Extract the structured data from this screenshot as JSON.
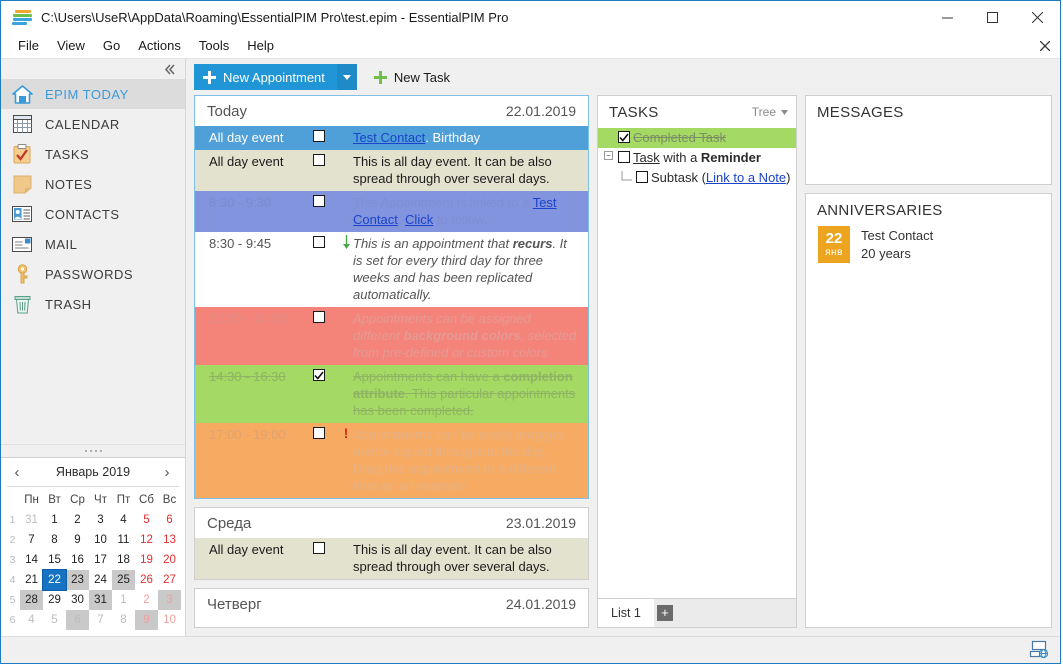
{
  "window": {
    "title": "C:\\Users\\UseR\\AppData\\Roaming\\EssentialPIM Pro\\test.epim - EssentialPIM Pro",
    "minimize_label": "Minimize",
    "maximize_label": "Maximize",
    "close_label": "Close"
  },
  "menu": {
    "items": [
      "File",
      "View",
      "Go",
      "Actions",
      "Tools",
      "Help"
    ],
    "close_label": "Close document"
  },
  "sidebar": {
    "collapse_label": "«",
    "items": [
      {
        "label": "EPIM TODAY",
        "icon": "home-icon",
        "active": true
      },
      {
        "label": "CALENDAR",
        "icon": "calendar-icon",
        "active": false
      },
      {
        "label": "TASKS",
        "icon": "tasks-clipboard-icon",
        "active": false
      },
      {
        "label": "NOTES",
        "icon": "note-icon",
        "active": false
      },
      {
        "label": "CONTACTS",
        "icon": "contact-card-icon",
        "active": false
      },
      {
        "label": "MAIL",
        "icon": "envelope-icon",
        "active": false
      },
      {
        "label": "PASSWORDS",
        "icon": "key-icon",
        "active": false
      },
      {
        "label": "TRASH",
        "icon": "trash-icon",
        "active": false
      }
    ]
  },
  "mini_calendar": {
    "title": "Январь 2019",
    "prev_label": "‹",
    "next_label": "›",
    "weekday_headers": [
      "Пн",
      "Вт",
      "Ср",
      "Чт",
      "Пт",
      "Сб",
      "Вс"
    ],
    "week_numbers": [
      "1",
      "2",
      "3",
      "4",
      "5",
      "6"
    ],
    "weeks": [
      [
        {
          "d": "31",
          "dim": true
        },
        {
          "d": "1"
        },
        {
          "d": "2"
        },
        {
          "d": "3"
        },
        {
          "d": "4"
        },
        {
          "d": "5",
          "sun": true
        },
        {
          "d": "6",
          "sun": true
        }
      ],
      [
        {
          "d": "7"
        },
        {
          "d": "8"
        },
        {
          "d": "9"
        },
        {
          "d": "10"
        },
        {
          "d": "11"
        },
        {
          "d": "12",
          "sun": true
        },
        {
          "d": "13",
          "sun": true
        }
      ],
      [
        {
          "d": "14"
        },
        {
          "d": "15"
        },
        {
          "d": "16"
        },
        {
          "d": "17"
        },
        {
          "d": "18"
        },
        {
          "d": "19",
          "sun": true
        },
        {
          "d": "20",
          "sun": true
        }
      ],
      [
        {
          "d": "21"
        },
        {
          "d": "22",
          "sel": true
        },
        {
          "d": "23",
          "shade": true
        },
        {
          "d": "24"
        },
        {
          "d": "25",
          "shade": true
        },
        {
          "d": "26",
          "sun": true
        },
        {
          "d": "27",
          "sun": true
        }
      ],
      [
        {
          "d": "28",
          "shade": true
        },
        {
          "d": "29"
        },
        {
          "d": "30"
        },
        {
          "d": "31",
          "shade": true
        },
        {
          "d": "1",
          "dim": true
        },
        {
          "d": "2",
          "dim": true,
          "sun": true
        },
        {
          "d": "3",
          "dim": true,
          "sun": true,
          "shade": true
        }
      ],
      [
        {
          "d": "4",
          "dim": true
        },
        {
          "d": "5",
          "dim": true
        },
        {
          "d": "6",
          "dim": true,
          "shade": true
        },
        {
          "d": "7",
          "dim": true
        },
        {
          "d": "8",
          "dim": true
        },
        {
          "d": "9",
          "dim": true,
          "sun": true,
          "shade": true
        },
        {
          "d": "10",
          "dim": true,
          "sun": true
        }
      ]
    ]
  },
  "toolbar": {
    "new_appointment_label": "New Appointment",
    "new_appointment_dropdown": "▾",
    "new_task_label": "New Task"
  },
  "today": {
    "day_name": "Today",
    "date": "22.01.2019",
    "appointments": [
      {
        "time": "All day event",
        "checked": false,
        "style": "selected",
        "segments": [
          {
            "t": "Test Contact",
            "link": true
          },
          {
            "t": ". Birthday"
          }
        ]
      },
      {
        "time": "All day event",
        "checked": false,
        "style": "allday",
        "segments": [
          {
            "t": "This is all day event. It can be also spread through over several days."
          }
        ]
      },
      {
        "time": "8:30 - 9:30",
        "checked": false,
        "style": "linked",
        "segments": [
          {
            "t": "This Appointment is linked to a "
          },
          {
            "t": "Test Contact",
            "link": true
          },
          {
            "t": ". "
          },
          {
            "t": "Click",
            "link": true
          },
          {
            "t": " to follow."
          }
        ]
      },
      {
        "time": "8:30 - 9:45",
        "checked": false,
        "style": "plain",
        "mark": "recurrence-arrow-icon",
        "italic": true,
        "segments": [
          {
            "t": "This is an appointment that "
          },
          {
            "t": "recurs",
            "bold": true
          },
          {
            "t": ". It is set for every third day for three weeks and has been replicated automatically."
          }
        ]
      },
      {
        "time": "12:30 - 14:30",
        "checked": false,
        "style": "red",
        "italic": true,
        "segments": [
          {
            "t": "Appointments can be assigned different "
          },
          {
            "t": "background colors",
            "bold": true
          },
          {
            "t": ", selected from pre-defined or custom colors."
          }
        ]
      },
      {
        "time": "14:30 - 16:30",
        "checked": true,
        "style": "green",
        "strike": true,
        "segments": [
          {
            "t": "Appointments can have a "
          },
          {
            "t": "completion attribute",
            "bold": true
          },
          {
            "t": ". This particular appointments has been completed."
          }
        ]
      },
      {
        "time": "17:00 - 19:00",
        "checked": false,
        "style": "orange",
        "mark": "priority-exclamation-icon",
        "segments": [
          {
            "t": "Appointments can be easily dragged and/or copied throughout the day. Drag this appointment to a different time as an example."
          }
        ]
      }
    ]
  },
  "wednesday": {
    "day_name": "Среда",
    "date": "23.01.2019",
    "appointments": [
      {
        "time": "All day event",
        "checked": false,
        "style": "allday",
        "segments": [
          {
            "t": "This is all day event. It can be also spread through over several days."
          }
        ]
      }
    ]
  },
  "thursday": {
    "day_name": "Четверг",
    "date": "24.01.2019",
    "appointments": []
  },
  "tasks": {
    "title": "TASKS",
    "view_mode": "Tree",
    "view_mode_caret": "▾",
    "rows": [
      {
        "indent": 0,
        "expander": null,
        "checked": true,
        "done": true,
        "segments": [
          {
            "t": "Completed Task"
          }
        ]
      },
      {
        "indent": 0,
        "expander": "−",
        "checked": false,
        "done": false,
        "segments": [
          {
            "t": "Task",
            "underline": true
          },
          {
            "t": " with a "
          },
          {
            "t": "Reminder",
            "bold": true
          }
        ]
      },
      {
        "indent": 1,
        "expander": null,
        "checked": false,
        "done": false,
        "segments": [
          {
            "t": "Subtask ("
          },
          {
            "t": "Link to a Note",
            "link": true
          },
          {
            "t": ")"
          }
        ]
      }
    ],
    "list_tab": "List 1",
    "add_list_label": "+"
  },
  "messages": {
    "title": "MESSAGES"
  },
  "anniversaries": {
    "title": "ANNIVERSARIES",
    "items": [
      {
        "day": "22",
        "month": "янв",
        "name": "Test Contact",
        "detail": "20 years"
      }
    ]
  },
  "status": {
    "sync_icon": "sync-globe-icon"
  },
  "colors": {
    "accent": "#2196d6",
    "selected_row": "#4f9fd8",
    "allday_row": "#e3e2cf",
    "linked_row": "#8294dd",
    "red_row": "#f4837a",
    "green_row": "#a4d963",
    "orange_row": "#f7ab62",
    "badge_orange": "#eda520",
    "link": "#1b44c8"
  }
}
